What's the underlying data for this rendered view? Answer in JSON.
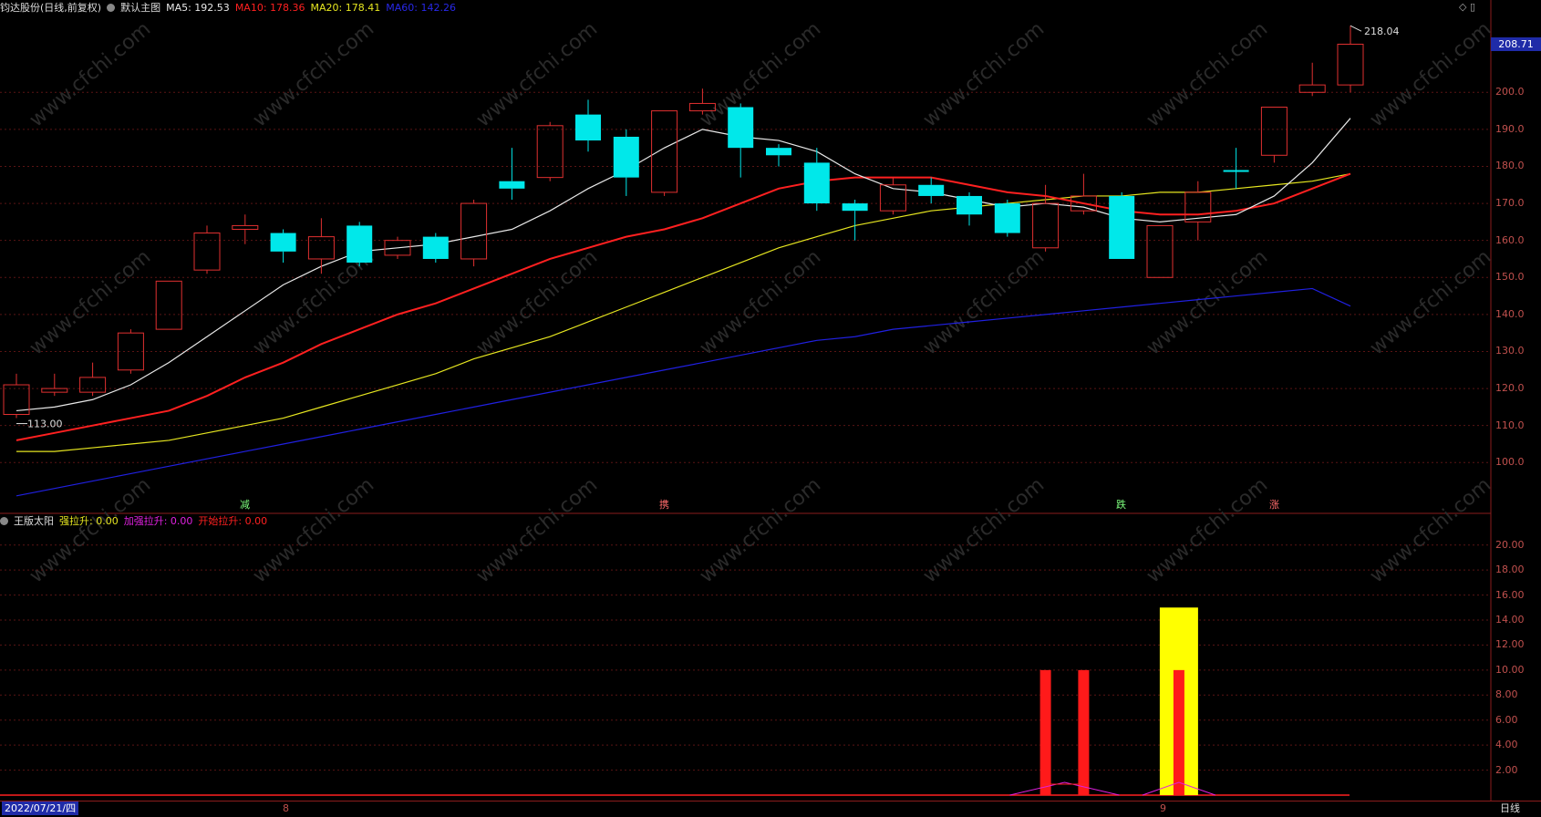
{
  "header": {
    "stock": "钧达股份(日线,前复权)",
    "main_chart_name": "默认主图",
    "ma5": "MA5: 192.53",
    "ma10": "MA10: 178.36",
    "ma20": "MA20: 178.41",
    "ma60": "MA60: 142.26"
  },
  "price_label": "208.71",
  "high_label": "218.04",
  "low_label": "113.00",
  "price_axis": [
    "200.0",
    "190.0",
    "180.0",
    "170.0",
    "160.0",
    "150.0",
    "140.0",
    "130.0",
    "120.0",
    "110.0",
    "100.0"
  ],
  "indicator": {
    "name": "王版太阳",
    "qls": "强拉升: 0.00",
    "jqls": "加强拉升: 0.00",
    "ksls": "开始拉升: 0.00",
    "axis": [
      "20.00",
      "18.00",
      "16.00",
      "14.00",
      "12.00",
      "10.00",
      "8.00",
      "6.00",
      "4.00",
      "2.00"
    ]
  },
  "signals": [
    {
      "text": "减",
      "color": "#7CFC7C"
    },
    {
      "text": "携",
      "color": "#ff6b6b"
    },
    {
      "text": "跌",
      "color": "#7CFC7C"
    },
    {
      "text": "涨",
      "color": "#ff6b6b"
    }
  ],
  "footer": {
    "date": "2022/07/21/四",
    "month_a": "8",
    "month_b": "9",
    "period": "日线"
  },
  "watermark": "www.cfchi.com",
  "colors": {
    "ma5": "#e8e8e8",
    "ma10": "#ff2020",
    "ma20": "#e6e620",
    "ma60": "#2020e0",
    "up": "#e03030",
    "down": "#00e8ea"
  },
  "chart_data": {
    "type": "candlestick",
    "candles": [
      {
        "o": 113,
        "h": 124,
        "l": 112,
        "c": 121,
        "dir": "up"
      },
      {
        "o": 119,
        "h": 124,
        "l": 118,
        "c": 120,
        "dir": "up"
      },
      {
        "o": 119,
        "h": 127,
        "l": 118,
        "c": 123,
        "dir": "up"
      },
      {
        "o": 125,
        "h": 136,
        "l": 124,
        "c": 135,
        "dir": "up"
      },
      {
        "o": 136,
        "h": 149,
        "l": 136,
        "c": 149,
        "dir": "up"
      },
      {
        "o": 152,
        "h": 164,
        "l": 151,
        "c": 162,
        "dir": "up"
      },
      {
        "o": 163,
        "h": 167,
        "l": 159,
        "c": 164,
        "dir": "up"
      },
      {
        "o": 162,
        "h": 163,
        "l": 154,
        "c": 157,
        "dir": "down"
      },
      {
        "o": 155,
        "h": 166,
        "l": 151,
        "c": 161,
        "dir": "up"
      },
      {
        "o": 164,
        "h": 165,
        "l": 153,
        "c": 154,
        "dir": "down"
      },
      {
        "o": 156,
        "h": 161,
        "l": 155,
        "c": 160,
        "dir": "up"
      },
      {
        "o": 161,
        "h": 162,
        "l": 154,
        "c": 155,
        "dir": "down"
      },
      {
        "o": 155,
        "h": 171,
        "l": 153,
        "c": 170,
        "dir": "up"
      },
      {
        "o": 176,
        "h": 185,
        "l": 171,
        "c": 174,
        "dir": "down"
      },
      {
        "o": 177,
        "h": 192,
        "l": 176,
        "c": 191,
        "dir": "up"
      },
      {
        "o": 194,
        "h": 198,
        "l": 184,
        "c": 187,
        "dir": "down"
      },
      {
        "o": 188,
        "h": 190,
        "l": 172,
        "c": 177,
        "dir": "down"
      },
      {
        "o": 173,
        "h": 195,
        "l": 172,
        "c": 195,
        "dir": "up"
      },
      {
        "o": 195,
        "h": 201,
        "l": 194,
        "c": 197,
        "dir": "up"
      },
      {
        "o": 196,
        "h": 197,
        "l": 177,
        "c": 185,
        "dir": "down"
      },
      {
        "o": 185,
        "h": 186,
        "l": 180,
        "c": 183,
        "dir": "down"
      },
      {
        "o": 181,
        "h": 185,
        "l": 168,
        "c": 170,
        "dir": "down"
      },
      {
        "o": 170,
        "h": 171,
        "l": 160,
        "c": 168,
        "dir": "down"
      },
      {
        "o": 168,
        "h": 177,
        "l": 167,
        "c": 175,
        "dir": "up"
      },
      {
        "o": 175,
        "h": 177,
        "l": 170,
        "c": 172,
        "dir": "down"
      },
      {
        "o": 172,
        "h": 173,
        "l": 164,
        "c": 167,
        "dir": "down"
      },
      {
        "o": 170,
        "h": 171,
        "l": 161,
        "c": 162,
        "dir": "down"
      },
      {
        "o": 158,
        "h": 175,
        "l": 157,
        "c": 170,
        "dir": "up"
      },
      {
        "o": 168,
        "h": 178,
        "l": 167,
        "c": 172,
        "dir": "up"
      },
      {
        "o": 172,
        "h": 173,
        "l": 155,
        "c": 155,
        "dir": "down"
      },
      {
        "o": 150,
        "h": 164,
        "l": 150,
        "c": 164,
        "dir": "up"
      },
      {
        "o": 165,
        "h": 176,
        "l": 160,
        "c": 173,
        "dir": "up"
      },
      {
        "o": 179,
        "h": 185,
        "l": 174,
        "c": 179,
        "dir": "down"
      },
      {
        "o": 183,
        "h": 196,
        "l": 181,
        "c": 196,
        "dir": "up"
      },
      {
        "o": 200,
        "h": 208,
        "l": 199,
        "c": 202,
        "dir": "up"
      },
      {
        "o": 202,
        "h": 218,
        "l": 200,
        "c": 213,
        "dir": "up"
      }
    ],
    "ma5": [
      114,
      115,
      117,
      121,
      127,
      134,
      141,
      148,
      153,
      157,
      158,
      159,
      161,
      163,
      168,
      174,
      179,
      185,
      190,
      188,
      187,
      184,
      178,
      174,
      173,
      171,
      169,
      170,
      169,
      166,
      165,
      166,
      167,
      172,
      181,
      193
    ],
    "ma10": [
      106,
      108,
      110,
      112,
      114,
      118,
      123,
      127,
      132,
      136,
      140,
      143,
      147,
      151,
      155,
      158,
      161,
      163,
      166,
      170,
      174,
      176,
      177,
      177,
      177,
      175,
      173,
      172,
      170,
      168,
      167,
      167,
      168,
      170,
      174,
      178
    ],
    "ma20": [
      103,
      103,
      104,
      105,
      106,
      108,
      110,
      112,
      115,
      118,
      121,
      124,
      128,
      131,
      134,
      138,
      142,
      146,
      150,
      154,
      158,
      161,
      164,
      166,
      168,
      169,
      170,
      171,
      172,
      172,
      173,
      173,
      174,
      175,
      176,
      178
    ],
    "ma60": [
      91,
      93,
      95,
      97,
      99,
      101,
      103,
      105,
      107,
      109,
      111,
      113,
      115,
      117,
      119,
      121,
      123,
      125,
      127,
      129,
      131,
      133,
      134,
      136,
      137,
      138,
      139,
      140,
      141,
      142,
      143,
      144,
      145,
      146,
      147,
      142.26
    ],
    "ylim": [
      88,
      221
    ],
    "indicator_bars": [
      {
        "idx": 27,
        "value": 10,
        "color": "#ff1a1a"
      },
      {
        "idx": 28,
        "value": 10,
        "color": "#ff1a1a"
      },
      {
        "idx": 30.5,
        "value": 15,
        "color": "#ffff00",
        "wide": true
      },
      {
        "idx": 30.5,
        "value": 10,
        "color": "#ff1a1a"
      }
    ],
    "indicator_ylim": [
      0,
      21
    ]
  }
}
